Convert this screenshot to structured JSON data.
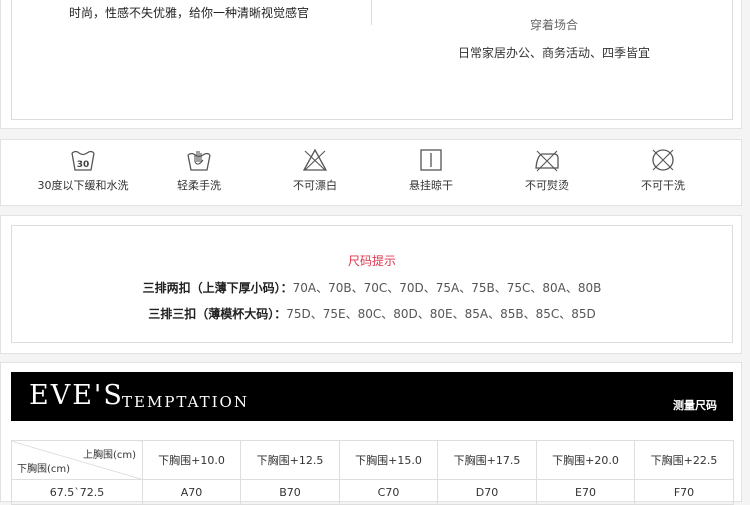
{
  "intro": {
    "tagline": "时尚，性感不失优雅，给你一种清晰视觉感官",
    "occasion_title": "穿着场合",
    "occasion_text": "日常家居办公、商务活动、四季皆宜"
  },
  "care": [
    {
      "label": "30度以下缓和水洗",
      "icon": "wash-30-icon"
    },
    {
      "label": "轻柔手洗",
      "icon": "hand-wash-icon"
    },
    {
      "label": "不可漂白",
      "icon": "no-bleach-icon"
    },
    {
      "label": "悬挂晾干",
      "icon": "hang-dry-icon"
    },
    {
      "label": "不可熨烫",
      "icon": "no-iron-icon"
    },
    {
      "label": "不可干洗",
      "icon": "no-dry-clean-icon"
    }
  ],
  "size_tips": {
    "title": "尺码提示",
    "row1_label": "三排两扣（上薄下厚小码）：",
    "row1_values": "70A、70B、70C、70D、75A、75B、75C、80A、80B",
    "row2_label": "三排三扣（薄模杯大码）：",
    "row2_values": "75D、75E、80C、80D、80E、85A、85B、85C、85D"
  },
  "banner": {
    "brand_main": "EVE'S",
    "brand_sub": "TEMPTATION",
    "measure_label": "测量尺码"
  },
  "size_table": {
    "corner_top": "上胸围(cm)",
    "corner_bottom": "下胸围(cm)",
    "headers": [
      "下胸围+10.0",
      "下胸围+12.5",
      "下胸围+15.0",
      "下胸围+17.5",
      "下胸围+20.0",
      "下胸围+22.5"
    ],
    "rows": [
      {
        "range": "67.5`72.5",
        "cells": [
          "A70",
          "B70",
          "C70",
          "D70",
          "E70",
          "F70"
        ]
      }
    ]
  }
}
